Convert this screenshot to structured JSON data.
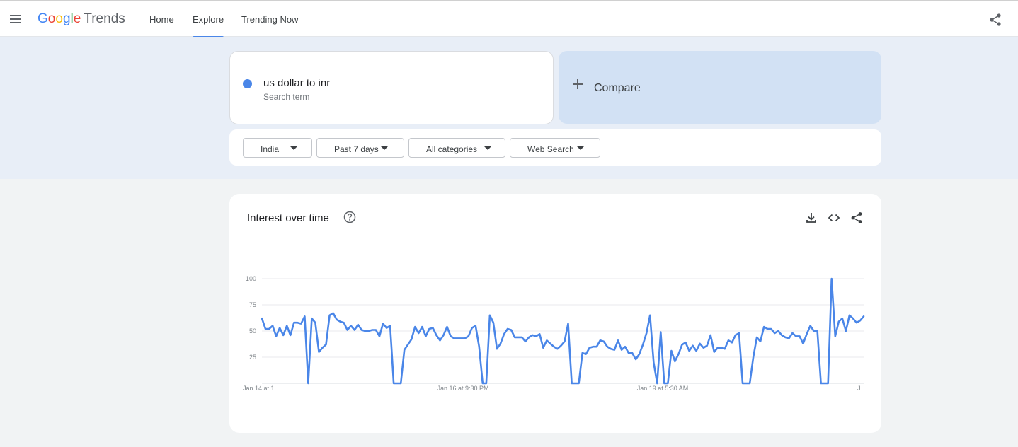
{
  "header": {
    "logo_letters": [
      "G",
      "o",
      "o",
      "g",
      "l",
      "e"
    ],
    "logo_suffix": "Trends",
    "tabs": [
      {
        "label": "Home",
        "active": false
      },
      {
        "label": "Explore",
        "active": true
      },
      {
        "label": "Trending Now",
        "active": false
      }
    ],
    "icons": {
      "menu": "hamburger-menu-icon",
      "share": "share-icon"
    }
  },
  "search": {
    "term": "us dollar to inr",
    "term_type": "Search term",
    "term_color": "#4a86e8",
    "compare_label": "Compare"
  },
  "filters": [
    {
      "label": "India"
    },
    {
      "label": "Past 7 days"
    },
    {
      "label": "All categories"
    },
    {
      "label": "Web Search"
    }
  ],
  "chart": {
    "title": "Interest over time",
    "icons": [
      "help-icon",
      "download-icon",
      "embed-code-icon",
      "share-icon"
    ]
  },
  "chart_data": {
    "type": "line",
    "ylim": [
      0,
      100
    ],
    "yticks": [
      25,
      50,
      75,
      100
    ],
    "grid": true,
    "x_tick_labels": [
      "Jan 14 at 1...",
      "Jan 16 at 9:30 PM",
      "Jan 19 at 5:30 AM",
      "J..."
    ],
    "series": [
      {
        "color": "#4a86e8",
        "values": [
          62,
          52,
          52,
          55,
          45,
          53,
          46,
          55,
          46,
          58,
          58,
          57,
          64,
          0,
          62,
          58,
          30,
          34,
          37,
          65,
          67,
          61,
          59,
          58,
          51,
          55,
          51,
          56,
          51,
          50,
          50,
          51,
          51,
          45,
          57,
          53,
          55,
          0,
          0,
          0,
          32,
          37,
          42,
          54,
          48,
          54,
          45,
          52,
          53,
          46,
          41,
          46,
          54,
          45,
          43,
          43,
          43,
          43,
          45,
          53,
          55,
          35,
          0,
          0,
          65,
          58,
          33,
          38,
          47,
          52,
          51,
          44,
          44,
          44,
          40,
          44,
          46,
          45,
          47,
          34,
          41,
          38,
          35,
          33,
          36,
          40,
          57,
          0,
          0,
          0,
          29,
          28,
          34,
          35,
          35,
          41,
          40,
          35,
          33,
          32,
          41,
          32,
          35,
          29,
          29,
          23,
          28,
          37,
          48,
          65,
          20,
          0,
          49,
          0,
          0,
          31,
          21,
          28,
          37,
          39,
          31,
          36,
          31,
          38,
          34,
          36,
          46,
          30,
          34,
          34,
          33,
          41,
          39,
          46,
          48,
          0,
          0,
          0,
          25,
          44,
          40,
          54,
          52,
          52,
          48,
          50,
          46,
          44,
          43,
          48,
          45,
          45,
          38,
          47,
          55,
          50,
          50,
          0,
          0,
          0,
          100,
          45,
          59,
          62,
          50,
          65,
          62,
          58,
          60,
          64
        ]
      }
    ]
  }
}
